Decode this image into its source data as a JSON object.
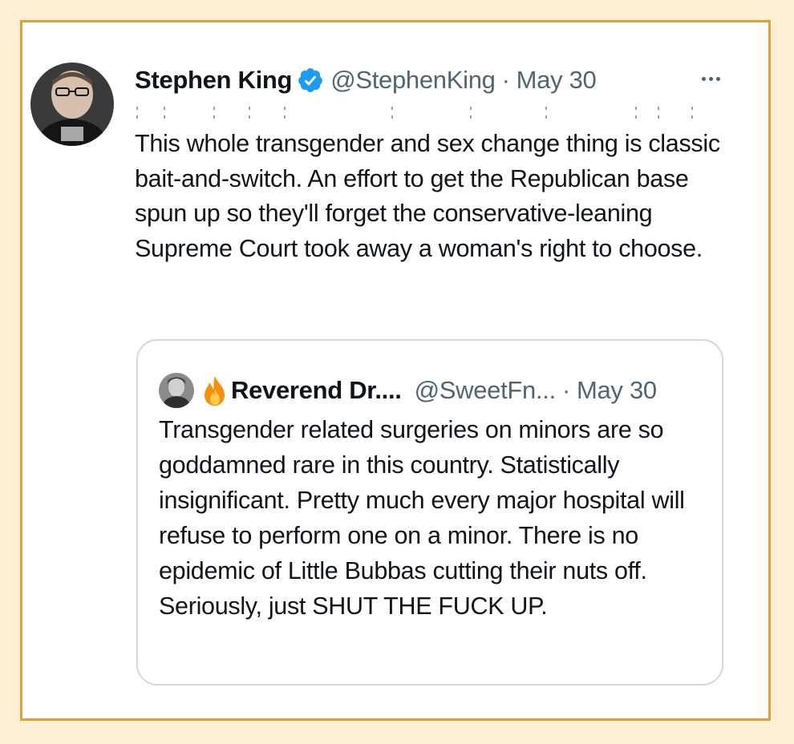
{
  "tweet": {
    "author_name": "Stephen King",
    "handle": "@StephenKing",
    "separator": "·",
    "date": "May 30",
    "text": "This whole transgender and sex change thing is classic bait-and-switch. An effort to get the Republican base spun up so they'll forget the conservative-leaning Supreme Court took away a woman's right to choose.",
    "verified_icon": "verified-badge-icon",
    "more_icon": "more-options-icon"
  },
  "quoted_tweet": {
    "author_name": "Reverend Dr....",
    "handle": "@SweetFn...",
    "separator": "·",
    "date": "May 30",
    "name_emoji_icon": "fire-icon",
    "text": "Transgender related surgeries on minors are so goddamned rare in this country. Statistically insignificant. Pretty much every major hospital will refuse to perform one on a minor. There is no epidemic of Little Bubbas cutting their nuts off. Seriously, just SHUT THE FUCK UP."
  },
  "colors": {
    "page_background": "#fdefd4",
    "frame_border": "#e0a03c",
    "text_primary": "#0f1419",
    "text_secondary": "#536471",
    "verified_blue": "#1d9bf0",
    "quote_border": "#d4d8dc"
  }
}
